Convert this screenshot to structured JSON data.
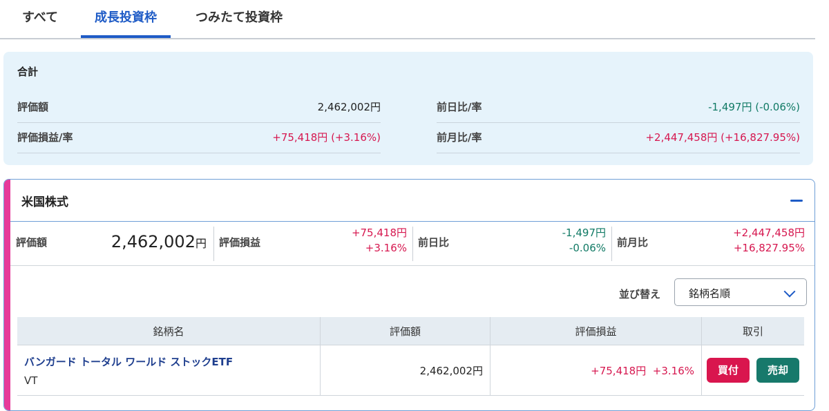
{
  "tabs": [
    {
      "label": "すべて"
    },
    {
      "label": "成長投資枠"
    },
    {
      "label": "つみたて投資枠"
    }
  ],
  "summary": {
    "title": "合計",
    "valuation_label": "評価額",
    "valuation_value": "2,462,002円",
    "pl_label": "評価損益/率",
    "pl_value": "+75,418円 (+3.16%)",
    "day_label": "前日比/率",
    "day_value": "-1,497円 (-0.06%)",
    "month_label": "前月比/率",
    "month_value": "+2,447,458円 (+16,827.95%)"
  },
  "section": {
    "title": "米国株式",
    "valuation_label": "評価額",
    "valuation_number": "2,462,002",
    "valuation_unit": "円",
    "pl_label": "評価損益",
    "pl_amount": "+75,418円",
    "pl_rate": "+3.16%",
    "day_label": "前日比",
    "day_amount": "-1,497円",
    "day_rate": "-0.06%",
    "month_label": "前月比",
    "month_amount": "+2,447,458円",
    "month_rate": "+16,827.95%"
  },
  "sort": {
    "label": "並び替え",
    "selected": "銘柄名順"
  },
  "table": {
    "headers": [
      "銘柄名",
      "評価額",
      "評価損益",
      "取引"
    ],
    "rows": [
      {
        "name": "バンガード トータル ワールド ストックETF",
        "code": "VT",
        "valuation": "2,462,002円",
        "pl_amount": "+75,418円",
        "pl_rate": "+3.16%",
        "buy_label": "買付",
        "sell_label": "売却"
      }
    ]
  },
  "colors": {
    "accent_blue": "#1e5bc6",
    "positive_red": "#d6174f",
    "negative_green": "#117a65",
    "section_accent_pink": "#e73a9a",
    "summary_bg": "#e6f3fb"
  },
  "icons": {
    "collapse": "minus-icon",
    "dropdown": "chevron-down-icon"
  }
}
